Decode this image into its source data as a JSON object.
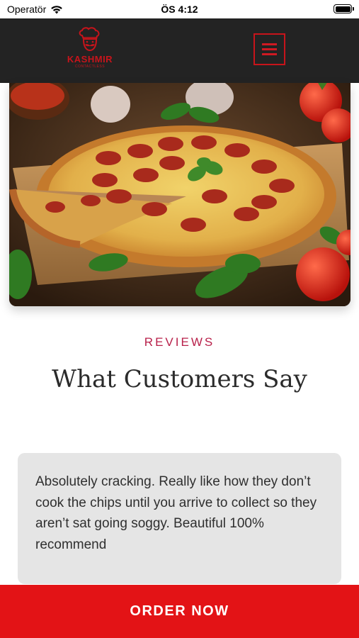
{
  "status_bar": {
    "carrier": "Operatör",
    "time": "ÖS 4:12"
  },
  "header": {
    "logo_text": "KASHMIR",
    "logo_subtext": "CONTACTLESS",
    "brand_color": "#c8141b",
    "background_color": "#232323"
  },
  "hero": {
    "image_description_icon": "pepperoni-pizza-image"
  },
  "reviews": {
    "eyebrow": "REVIEWS",
    "title": "What Customers Say",
    "items": [
      {
        "text": "Absolutely cracking. Really like how they don’t cook the chips until you arrive to collect so they aren’t sat going soggy. Beautiful 100% recommend"
      }
    ]
  },
  "order_button": {
    "label": "ORDER NOW",
    "color": "#e31316"
  }
}
